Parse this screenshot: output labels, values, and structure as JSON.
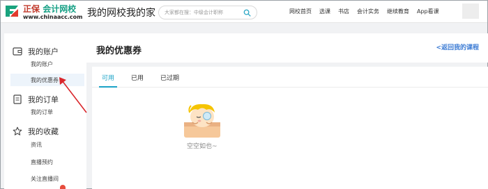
{
  "header": {
    "logo_cn_prefix": "正保",
    "logo_cn_suffix": "会计网校",
    "logo_url": "www.chinaacc.com",
    "site_title": "我的网校我的家",
    "search_placeholder": "大家都在搜：中级会计职称",
    "nav": [
      "网校首页",
      "选课",
      "书店",
      "会计实务",
      "继续教育",
      "App看课"
    ]
  },
  "sidebar": {
    "groups": [
      {
        "title": "我的账户",
        "items": [
          "我的账户",
          "我的优惠券"
        ]
      },
      {
        "title": "我的订单",
        "items": [
          "我的订单"
        ]
      },
      {
        "title": "我的收藏",
        "items": [
          "资讯",
          "直播预约",
          "关注直播间"
        ]
      }
    ],
    "active_item": "我的优惠券"
  },
  "main": {
    "title": "我的优惠券",
    "back_link": "<返回我的课程",
    "tabs": [
      "可用",
      "已用",
      "已过期"
    ],
    "active_tab": "可用",
    "empty_text": "空空如也~"
  },
  "colors": {
    "accent": "#1aa3c7",
    "brand_green": "#16a085",
    "link_blue": "#3b7bd4",
    "annotation_red": "#d9262b"
  }
}
